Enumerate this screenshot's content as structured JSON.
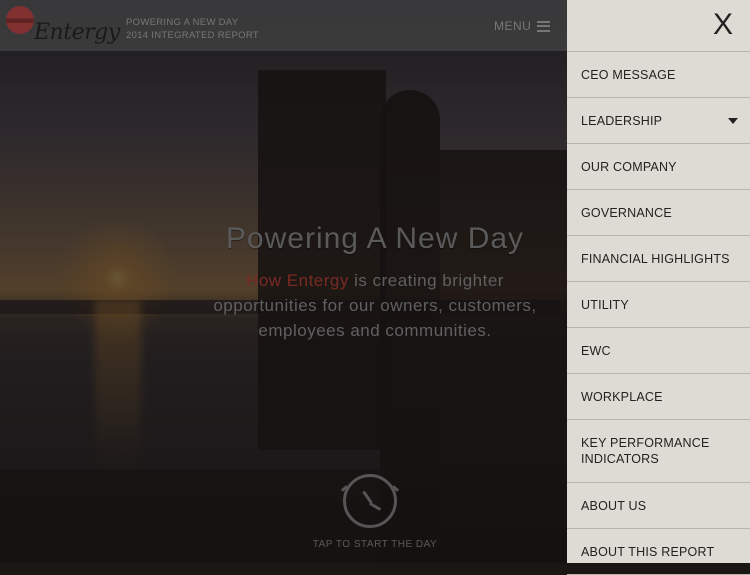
{
  "header": {
    "logo_text": "Entergy",
    "tagline_line1": "POWERING A NEW DAY",
    "tagline_line2": "2014 INTEGRATED REPORT",
    "menu_label": "MENU"
  },
  "hero": {
    "title": "Powering A New Day",
    "subtitle_brand": "How Entergy",
    "subtitle_rest": " is creating brighter opportunities for our owners, customers, employees and communities.",
    "tap_label": "TAP TO START THE DAY"
  },
  "menu": {
    "close_label": "X",
    "items": [
      {
        "label": "CEO MESSAGE"
      },
      {
        "label": "LEADERSHIP"
      },
      {
        "label": "OUR COMPANY"
      },
      {
        "label": "GOVERNANCE"
      },
      {
        "label": "FINANCIAL HIGHLIGHTS"
      },
      {
        "label": "UTILITY"
      },
      {
        "label": "EWC"
      },
      {
        "label": "WORKPLACE"
      },
      {
        "label": "KEY PERFORMANCE INDICATORS"
      },
      {
        "label": "ABOUT US"
      },
      {
        "label": "ABOUT THIS REPORT"
      }
    ]
  }
}
